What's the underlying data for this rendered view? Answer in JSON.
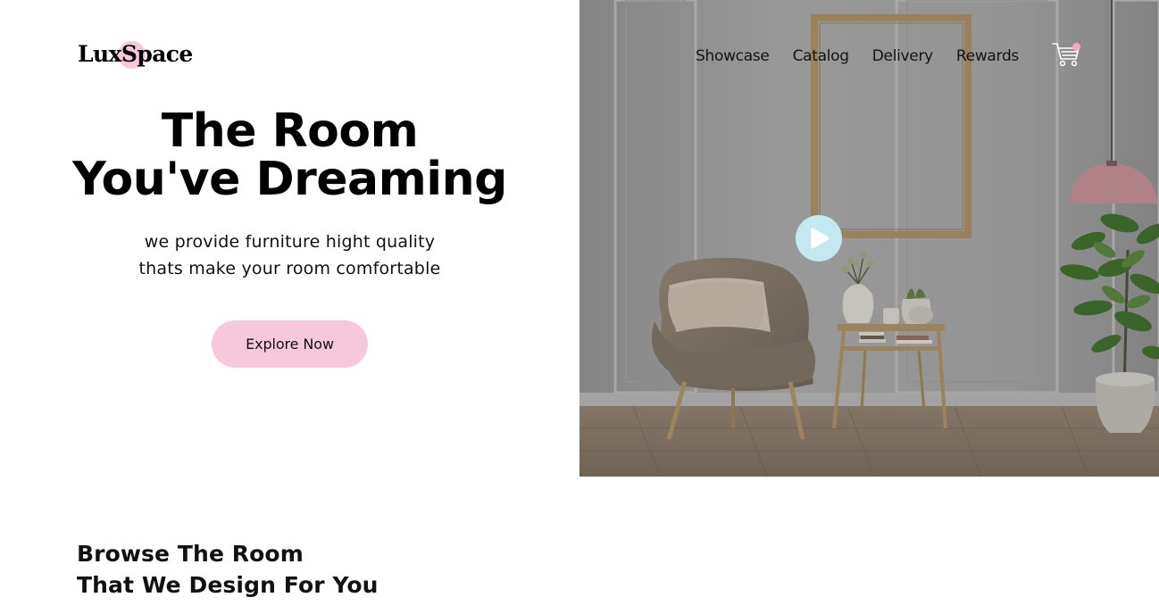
{
  "brand": {
    "name": "LuxSpace",
    "accent_color": "#f7c7dc"
  },
  "nav": {
    "items": [
      {
        "label": "Showcase"
      },
      {
        "label": "Catalog"
      },
      {
        "label": "Delivery"
      },
      {
        "label": "Rewards"
      }
    ],
    "cart_icon": "shopping-cart-icon",
    "cart_badge_color": "#f5a8c5"
  },
  "hero": {
    "title_line1": "The Room",
    "title_line2": "You've Dreaming",
    "subtitle_line1": "we provide furniture hight quality",
    "subtitle_line2": "thats make your room comfortable",
    "cta_label": "Explore Now",
    "cta_color": "#f7c7dc",
    "play_icon": "play-icon",
    "play_color": "#c3e8f0"
  },
  "browse": {
    "title_line1": "Browse The Room",
    "title_line2": "That We Design For You"
  }
}
